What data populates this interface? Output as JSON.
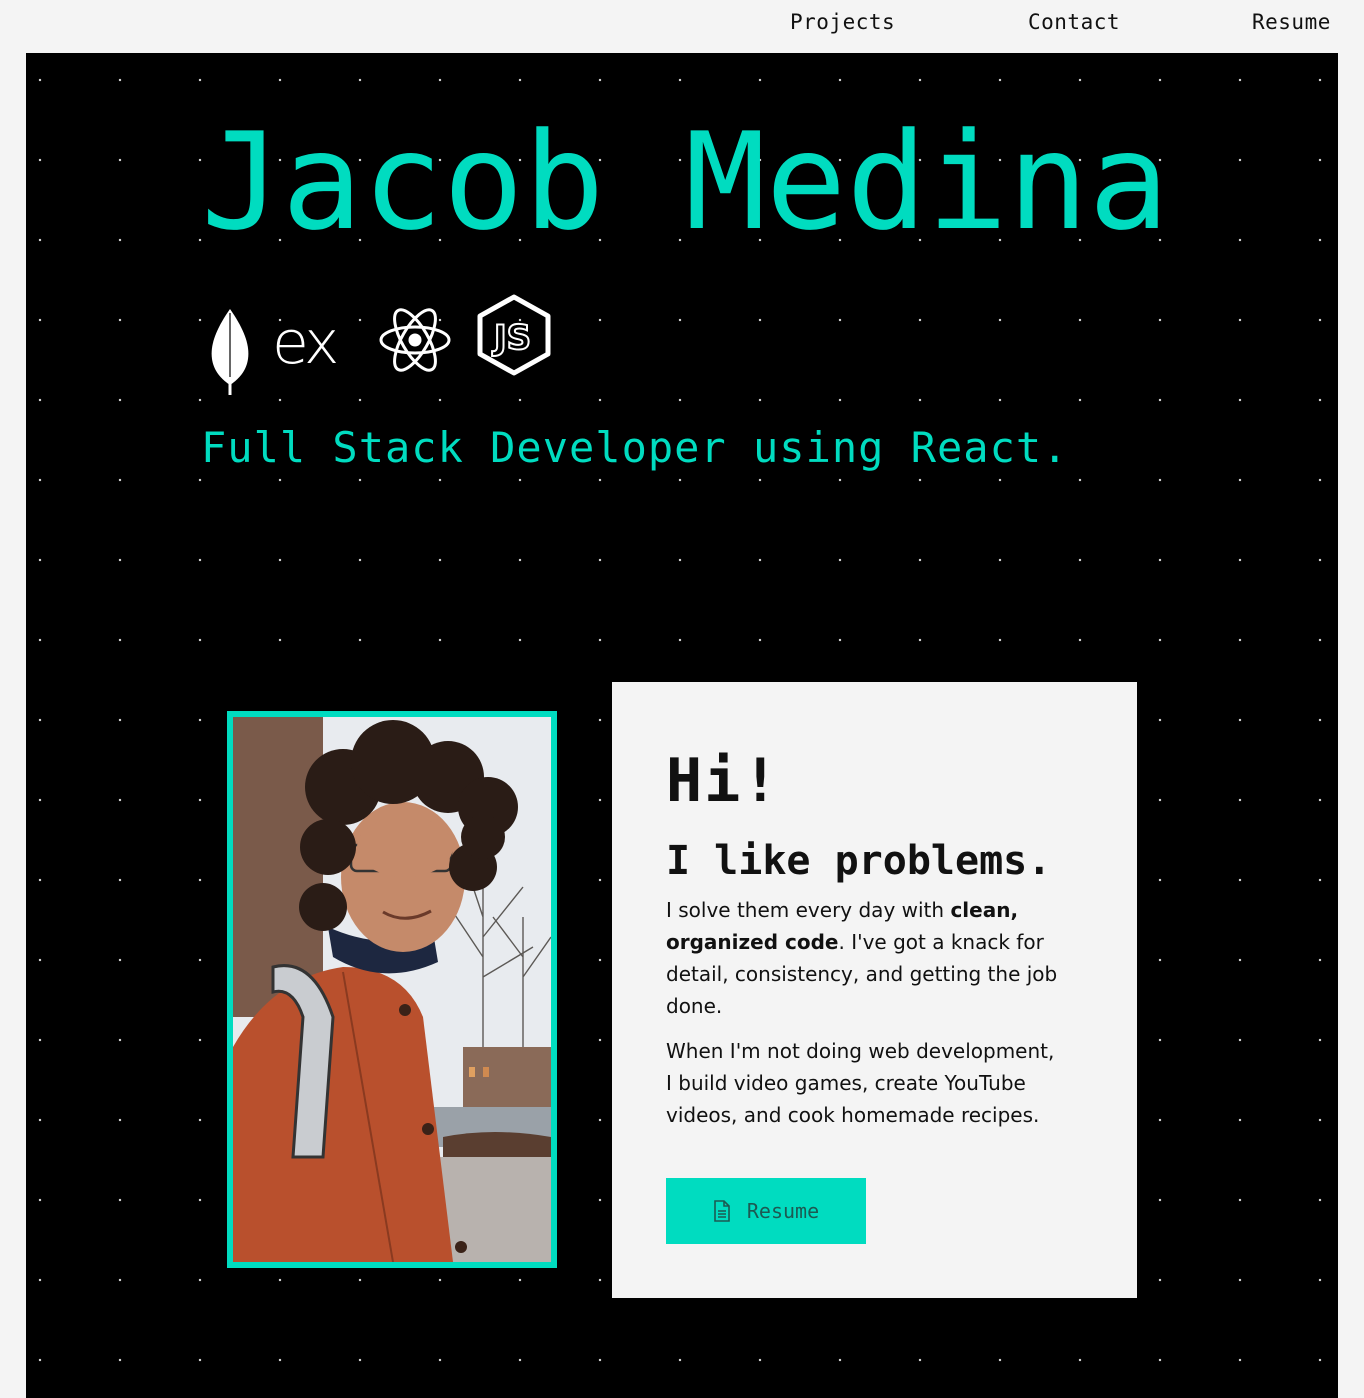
{
  "nav": {
    "items": [
      "Projects",
      "Contact",
      "Resume"
    ]
  },
  "hero": {
    "name": "Jacob Medina",
    "subtitle": "Full Stack Developer using React.",
    "tech_icons": [
      "mongodb-icon",
      "express-icon",
      "react-icon",
      "nodejs-icon"
    ],
    "express_label": "ex",
    "node_label": "JS"
  },
  "about": {
    "greeting": "Hi!",
    "tagline": "I like problems.",
    "para1_start": "I solve them every day with ",
    "para1_bold": "clean, organized code",
    "para1_end": ". I've got a knack for detail, consistency, and getting the job done.",
    "para2": "When I'm not doing web development, I build video games, create YouTube videos, and cook homemade recipes.",
    "resume_button": "Resume"
  },
  "colors": {
    "accent": "#00dcc0",
    "background": "#000000",
    "card": "#f4f4f4"
  }
}
